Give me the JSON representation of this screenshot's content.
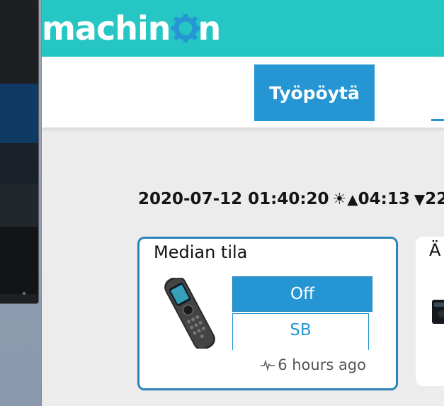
{
  "app": {
    "logo_text_left": "machin",
    "logo_text_right": "n",
    "brand_color": "#25c6c4",
    "accent_color": "#2596d3"
  },
  "nav": {
    "tabs": [
      {
        "label": "Työpöytä",
        "active": true
      }
    ]
  },
  "status": {
    "datetime": "2020-07-12 01:40:20",
    "sun_icon": "sun-icon",
    "sunrise_symbol": "▲",
    "sunrise": "04:13",
    "sunset_symbol": "▼",
    "sunset": "22"
  },
  "cards": [
    {
      "title": "Median tila",
      "image": "remote-control-image",
      "buttons": [
        {
          "label": "Off",
          "selected": true
        },
        {
          "label": "SB",
          "selected": false
        }
      ],
      "last_update_icon": "pulse-icon",
      "last_update": "6 hours ago"
    },
    {
      "title": "Ä",
      "image": "device-image"
    }
  ]
}
